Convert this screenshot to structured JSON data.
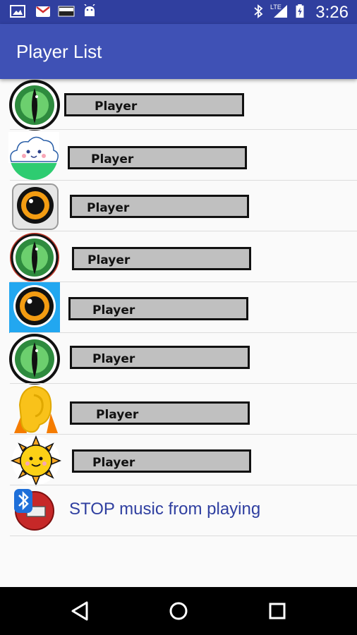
{
  "status_bar": {
    "time": "3:26",
    "network": "LTE",
    "notification_icons": [
      "gallery-icon",
      "gmail-icon",
      "good-icon",
      "android-icon"
    ],
    "colors": {
      "background": "#303f9f"
    }
  },
  "app_bar": {
    "title": "Player List",
    "colors": {
      "background": "#3f51b5"
    }
  },
  "players": [
    {
      "label": "Player",
      "icon": "snake-eye-icon"
    },
    {
      "label": "Player",
      "icon": "cloud-icon"
    },
    {
      "label": "Player",
      "icon": "round-eye-icon"
    },
    {
      "label": "Player",
      "icon": "snake-eye-icon"
    },
    {
      "label": "Player",
      "icon": "round-eye-blue-icon"
    },
    {
      "label": "Player",
      "icon": "snake-eye-icon"
    },
    {
      "label": "Player",
      "icon": "ear-icon"
    },
    {
      "label": "Player",
      "icon": "sun-icon"
    }
  ],
  "stop_item": {
    "label": "STOP music from playing",
    "icon": "bluetooth-stop-icon"
  },
  "nav_bar": {
    "buttons": [
      "back-icon",
      "home-icon",
      "recents-icon"
    ]
  }
}
